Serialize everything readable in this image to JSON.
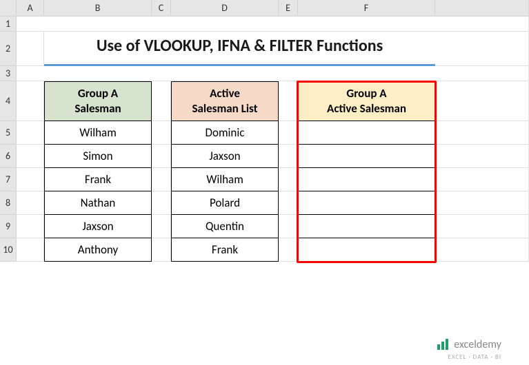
{
  "columns": [
    "A",
    "B",
    "C",
    "D",
    "E",
    "F"
  ],
  "rows": [
    "1",
    "2",
    "3",
    "4",
    "5",
    "6",
    "7",
    "8",
    "9",
    "10"
  ],
  "title": "Use of VLOOKUP, IFNA & FILTER Functions",
  "table_b": {
    "header": "Group A\nSalesman",
    "data": [
      "Wilham",
      "Simon",
      "Frank",
      "Nathan",
      "Jaxson",
      "Anthony"
    ]
  },
  "table_d": {
    "header": "Active\nSalesman List",
    "data": [
      "Dominic",
      "Jaxson",
      "Wilham",
      "Polard",
      "Quentin",
      "Frank"
    ]
  },
  "table_f": {
    "header": "Group A\nActive Salesman",
    "data": [
      "",
      "",
      "",
      "",
      "",
      ""
    ]
  },
  "logo": {
    "text": "exceldemy",
    "sub": "EXCEL · DATA · BI"
  }
}
